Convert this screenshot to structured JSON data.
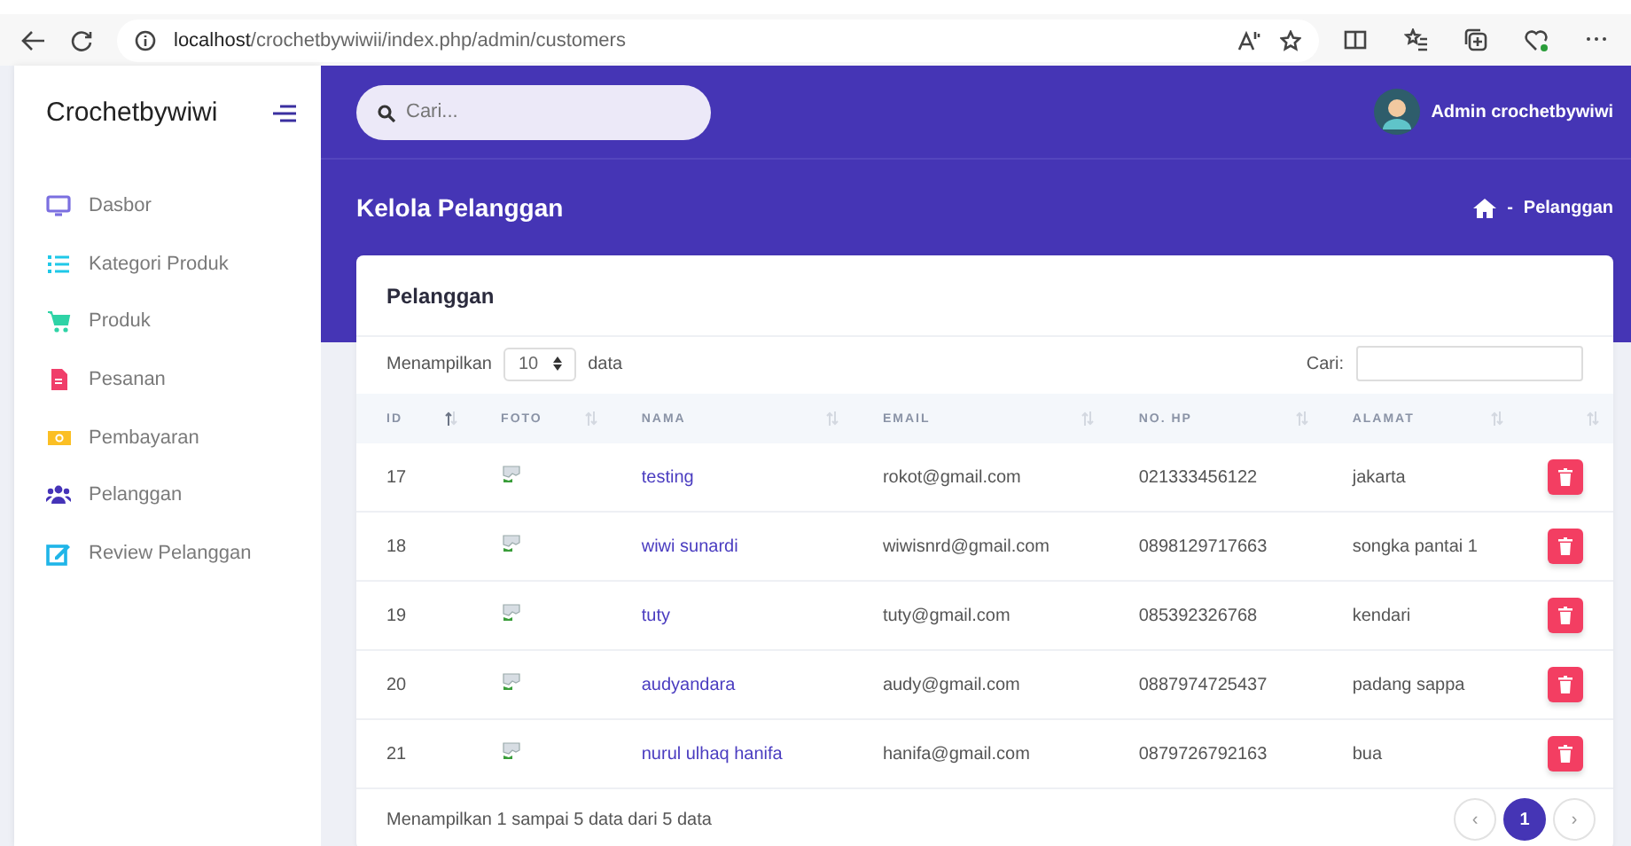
{
  "browser": {
    "url_host": "localhost",
    "url_path": "/crochetbywiwii/index.php/admin/customers"
  },
  "sidebar": {
    "brand": "Crochetbywiwi",
    "items": [
      {
        "label": "Dasbor",
        "color": "#7b6fe0"
      },
      {
        "label": "Kategori Produk",
        "color": "#1fc8e8"
      },
      {
        "label": "Produk",
        "color": "#2ed3a6"
      },
      {
        "label": "Pesanan",
        "color": "#f03e6a"
      },
      {
        "label": "Pembayaran",
        "color": "#fbbf24"
      },
      {
        "label": "Pelanggan",
        "color": "#4533b8"
      },
      {
        "label": "Review Pelanggan",
        "color": "#1fb5e8"
      }
    ]
  },
  "topbar": {
    "search_placeholder": "Cari...",
    "user": "Admin crochetbywiwi"
  },
  "page": {
    "title": "Kelola Pelanggan",
    "breadcrumb_separator": "-",
    "breadcrumb": "Pelanggan"
  },
  "card": {
    "title": "Pelanggan",
    "length_before": "Menampilkan",
    "length_value": "10",
    "length_after": "data",
    "search_label": "Cari:",
    "columns": [
      {
        "label": "ID",
        "sorted": true
      },
      {
        "label": "FOTO",
        "sorted": false
      },
      {
        "label": "NAMA",
        "sorted": false
      },
      {
        "label": "EMAIL",
        "sorted": false
      },
      {
        "label": "NO. HP",
        "sorted": false
      },
      {
        "label": "ALAMAT",
        "sorted": false
      }
    ],
    "rows": [
      {
        "id": "17",
        "name": "testing",
        "email": "rokot@gmail.com",
        "phone": "021333456122",
        "address": "jakarta"
      },
      {
        "id": "18",
        "name": "wiwi sunardi",
        "email": "wiwisnrd@gmail.com",
        "phone": "0898129717663",
        "address": "songka pantai 1"
      },
      {
        "id": "19",
        "name": "tuty",
        "email": "tuty@gmail.com",
        "phone": "085392326768",
        "address": "kendari"
      },
      {
        "id": "20",
        "name": "audyandara",
        "email": "audy@gmail.com",
        "phone": "0887974725437",
        "address": "padang sappa"
      },
      {
        "id": "21",
        "name": "nurul ulhaq hanifa",
        "email": "hanifa@gmail.com",
        "phone": "0879726792163",
        "address": "bua"
      }
    ],
    "info": "Menampilkan 1 sampai 5 data dari 5 data",
    "pagination": [
      {
        "label": "‹",
        "selected": false
      },
      {
        "label": "1",
        "selected": true
      },
      {
        "label": "›",
        "selected": false
      }
    ]
  }
}
